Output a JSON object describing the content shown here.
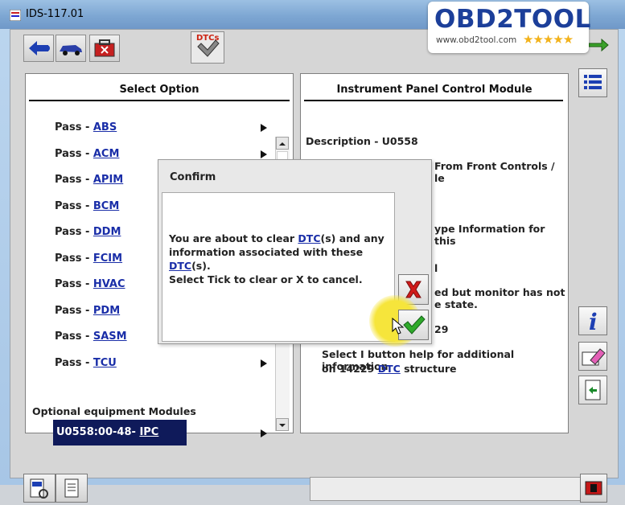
{
  "window": {
    "title": "IDS-117.01"
  },
  "brand": {
    "name": "OBD2TOOL",
    "url": "www.obd2tool.com",
    "stars": "★★★★★"
  },
  "toolbar": {
    "dtc_tab_label": "DTCs"
  },
  "left_panel": {
    "title": "Select Option",
    "items": [
      {
        "prefix": "Pass - ",
        "link": "ABS"
      },
      {
        "prefix": "Pass - ",
        "link": "ACM"
      },
      {
        "prefix": "Pass - ",
        "link": "APIM"
      },
      {
        "prefix": "Pass - ",
        "link": "BCM"
      },
      {
        "prefix": "Pass - ",
        "link": "DDM"
      },
      {
        "prefix": "Pass - ",
        "link": "FCIM"
      },
      {
        "prefix": "Pass - ",
        "link": "HVAC"
      },
      {
        "prefix": "Pass - ",
        "link": "PDM"
      },
      {
        "prefix": "Pass - ",
        "link": "SASM"
      },
      {
        "prefix": "Pass - ",
        "link": "TCU"
      }
    ],
    "selected": {
      "prefix": "U0558:00-48- ",
      "link": "IPC"
    },
    "footer_label": "Optional equipment Modules"
  },
  "right_panel": {
    "title": "Instrument Panel Control Module",
    "description": "Description - U0558",
    "line1": "From Front Controls /",
    "line2": "le",
    "line3": "ype Information for this",
    "line4": "l",
    "line5": "ed but monitor has not",
    "line6": "e state.",
    "line7": "29",
    "help_pre": "Select I button help for additional information",
    "help_mid": "on 14229 ",
    "help_link": "DTC",
    "help_post": " structure"
  },
  "dialog": {
    "title": "Confirm",
    "msg_a": "You are about to clear ",
    "msg_link1": "DTC",
    "msg_b": "(s) and any",
    "msg_c": "information associated with these ",
    "msg_link2": "DTC",
    "msg_d": "(s).",
    "msg_e": "Select Tick to clear or X to cancel."
  }
}
